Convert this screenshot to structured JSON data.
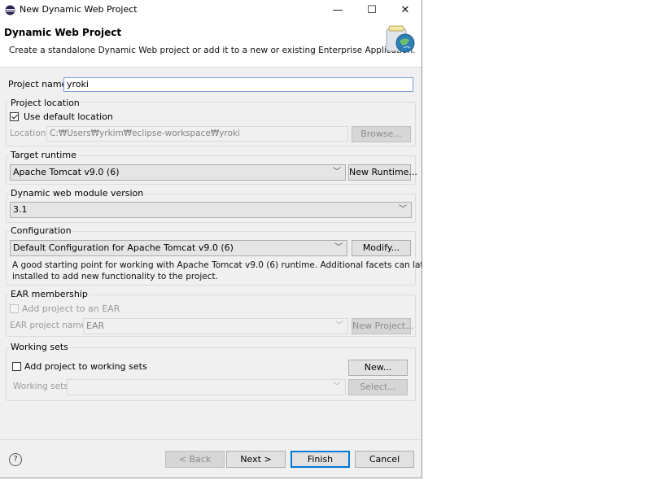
{
  "window": {
    "title": "New Dynamic Web Project",
    "minimize": "—",
    "maximize": "☐",
    "close": "✕"
  },
  "header": {
    "title": "Dynamic Web Project",
    "description": "Create a standalone Dynamic Web project or add it to a new or existing Enterprise Application."
  },
  "project_name": {
    "label": "Project name:",
    "value": "yroki"
  },
  "project_location": {
    "group_title": "Project location",
    "use_default_label": "Use default location",
    "use_default_checked": true,
    "location_label": "Location:",
    "location_value": "C:₩Users₩yrkim₩eclipse-workspace₩yroki",
    "browse_label": "Browse..."
  },
  "target_runtime": {
    "group_title": "Target runtime",
    "selected": "Apache Tomcat v9.0 (6)",
    "new_runtime_label": "New Runtime..."
  },
  "module_version": {
    "group_title": "Dynamic web module version",
    "selected": "3.1"
  },
  "configuration": {
    "group_title": "Configuration",
    "selected": "Default Configuration for Apache Tomcat v9.0 (6)",
    "modify_label": "Modify...",
    "description_line1": "A good starting point for working with Apache Tomcat v9.0 (6) runtime. Additional facets can later be",
    "description_line2": "installed to add new functionality to the project."
  },
  "ear": {
    "group_title": "EAR membership",
    "add_label": "Add project to an EAR",
    "name_label": "EAR project name:",
    "name_value": "EAR",
    "new_project_label": "New Project..."
  },
  "working_sets": {
    "group_title": "Working sets",
    "add_label": "Add project to working sets",
    "new_label": "New...",
    "sets_label": "Working sets:",
    "select_label": "Select..."
  },
  "footer": {
    "help": "?",
    "back_label": "< Back",
    "next_label": "Next >",
    "finish_label": "Finish",
    "cancel_label": "Cancel"
  },
  "colors": {
    "accent": "#0078d7",
    "dialog_bg": "#f0f0f0"
  }
}
